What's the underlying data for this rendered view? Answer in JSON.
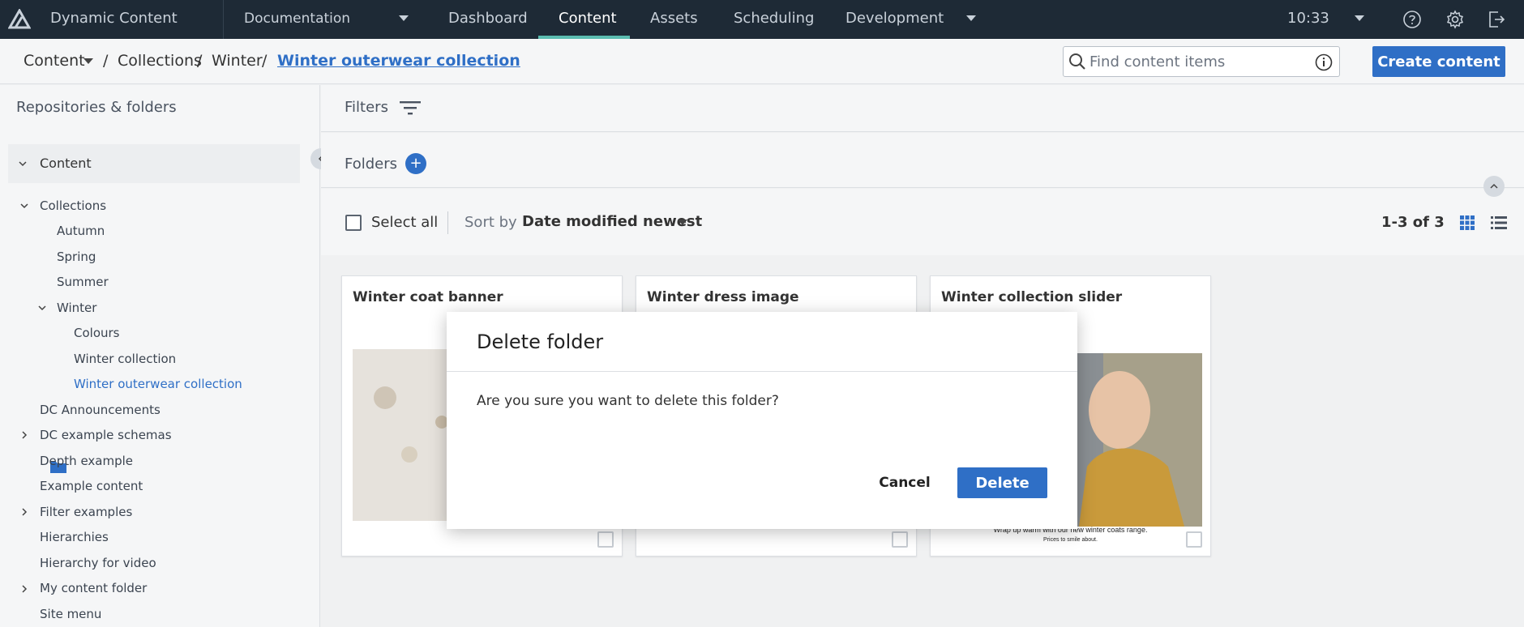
{
  "app": {
    "name": "Dynamic Content",
    "hub": "Documentation",
    "nav": [
      "Dashboard",
      "Content",
      "Assets",
      "Scheduling",
      "Development"
    ],
    "active_nav": "Content",
    "clock": "10:33",
    "icons": [
      "help-icon",
      "settings-icon",
      "logout-icon"
    ]
  },
  "breadcrumb": {
    "root": "Content",
    "items": [
      "Collections",
      "Winter"
    ],
    "current": "Winter outerwear collection",
    "separator": "/"
  },
  "search": {
    "placeholder": "Find content items"
  },
  "create_button": "Create content",
  "sidebar": {
    "title": "Repositories & folders",
    "root": "Content",
    "tree": [
      {
        "label": "Collections",
        "chevron": "down"
      },
      {
        "label": "Autumn"
      },
      {
        "label": "Spring"
      },
      {
        "label": "Summer"
      },
      {
        "label": "Winter",
        "chevron": "down"
      },
      {
        "label": "Colours"
      },
      {
        "label": "Winter collection"
      },
      {
        "label": "Winter outerwear collection",
        "selected": true
      },
      {
        "label": "DC Announcements"
      },
      {
        "label": "DC example schemas",
        "chevron": "right"
      },
      {
        "label": "Depth example"
      },
      {
        "label": "Example content"
      },
      {
        "label": "Filter examples",
        "chevron": "right"
      },
      {
        "label": "Hierarchies"
      },
      {
        "label": "Hierarchy for video"
      },
      {
        "label": "My content folder",
        "chevron": "right"
      },
      {
        "label": "Site menu"
      }
    ]
  },
  "main": {
    "filters_label": "Filters",
    "folders_label": "Folders",
    "select_all": "Select all",
    "sort_by_label": "Sort by",
    "sort_value": "Date modified newest",
    "count": "1-3 of 3"
  },
  "cards": [
    {
      "title": "Winter coat banner"
    },
    {
      "title": "Winter dress image"
    },
    {
      "title": "Winter collection slider",
      "caption": "Wrap up warm with our new winter coats range.",
      "subcaption": "Prices to smile about."
    }
  ],
  "modal": {
    "title": "Delete folder",
    "message": "Are you sure you want to delete this folder?",
    "cancel": "Cancel",
    "delete": "Delete"
  },
  "colors": {
    "nav_bg": "#1e2a36",
    "accent": "#2f6fc6",
    "active_tab": "#5bbcb0"
  }
}
